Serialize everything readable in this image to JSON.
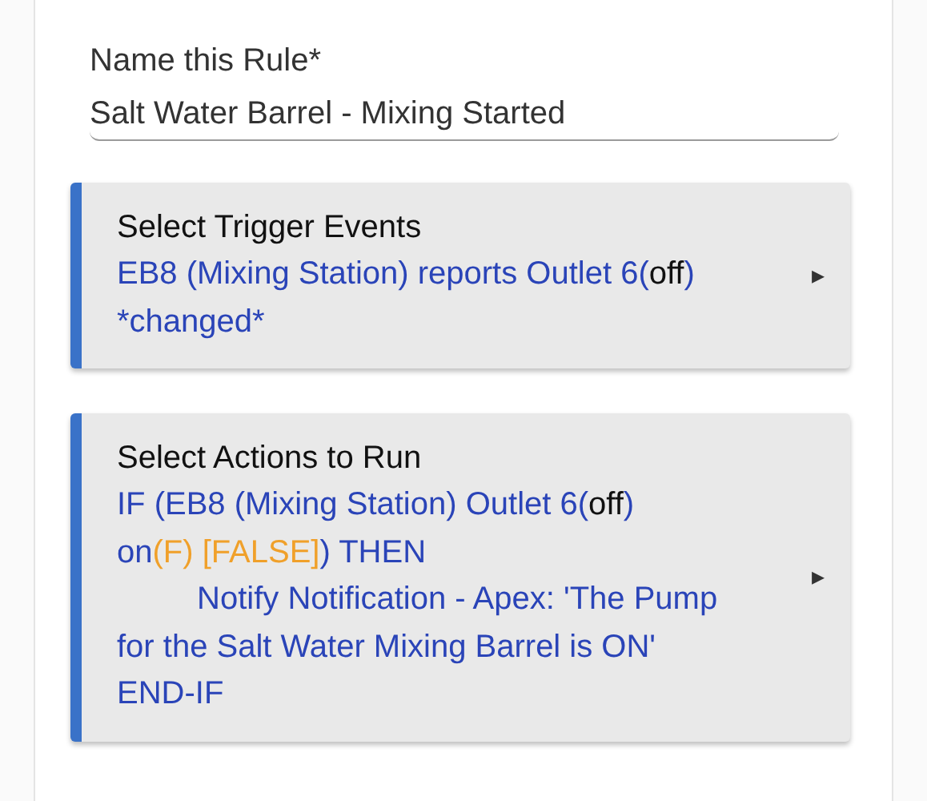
{
  "name_field": {
    "label": "Name this Rule*",
    "value": "Salt Water Barrel - Mixing Started"
  },
  "sections": [
    {
      "title": "Select Trigger Events",
      "arrow": "▸",
      "lines": [
        {
          "segments": [
            {
              "kind": "link",
              "text": "EB8 (Mixing Station) reports Outlet 6("
            },
            {
              "kind": "value",
              "text": "off"
            },
            {
              "kind": "link",
              "text": ")"
            }
          ]
        },
        {
          "segments": [
            {
              "kind": "link",
              "text": "*changed*"
            }
          ]
        }
      ]
    },
    {
      "title": "Select Actions to Run",
      "arrow": "▸",
      "lines": [
        {
          "segments": [
            {
              "kind": "link",
              "text": "IF (EB8 (Mixing Station) Outlet 6("
            },
            {
              "kind": "value",
              "text": "off"
            },
            {
              "kind": "link",
              "text": ")"
            }
          ]
        },
        {
          "segments": [
            {
              "kind": "link",
              "text": "on"
            },
            {
              "kind": "false",
              "text": "(F) [FALSE]"
            },
            {
              "kind": "link",
              "text": ") THEN"
            }
          ]
        },
        {
          "segments": [
            {
              "kind": "link",
              "text": "         Notify Notification - Apex: 'The Pump"
            }
          ]
        },
        {
          "segments": [
            {
              "kind": "link",
              "text": "for the Salt Water Mixing Barrel is ON'"
            }
          ]
        },
        {
          "segments": [
            {
              "kind": "link",
              "text": "END-IF"
            }
          ]
        }
      ]
    }
  ]
}
